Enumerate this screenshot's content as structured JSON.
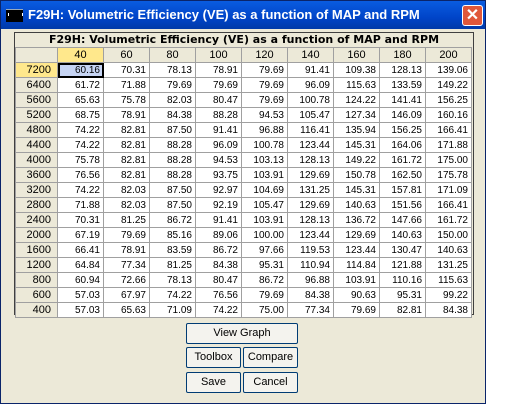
{
  "window": {
    "title": "F29H: Volumetric Efficiency (VE) as a function of MAP and RPM",
    "close_glyph": "✕"
  },
  "table": {
    "caption": "F29H: Volumetric Efficiency (VE) as a function of MAP and RPM",
    "columns": [
      "40",
      "60",
      "80",
      "100",
      "120",
      "140",
      "160",
      "180",
      "200"
    ],
    "selected_column": 0,
    "selected_row": 0,
    "rows": [
      {
        "rpm": "7200",
        "values": [
          "60.16",
          "70.31",
          "78.13",
          "78.91",
          "79.69",
          "91.41",
          "109.38",
          "128.13",
          "139.06"
        ]
      },
      {
        "rpm": "6400",
        "values": [
          "61.72",
          "71.88",
          "79.69",
          "79.69",
          "79.69",
          "96.09",
          "115.63",
          "133.59",
          "149.22"
        ]
      },
      {
        "rpm": "5600",
        "values": [
          "65.63",
          "75.78",
          "82.03",
          "80.47",
          "79.69",
          "100.78",
          "124.22",
          "141.41",
          "156.25"
        ]
      },
      {
        "rpm": "5200",
        "values": [
          "68.75",
          "78.91",
          "84.38",
          "88.28",
          "94.53",
          "105.47",
          "127.34",
          "146.09",
          "160.16"
        ]
      },
      {
        "rpm": "4800",
        "values": [
          "74.22",
          "82.81",
          "87.50",
          "91.41",
          "96.88",
          "116.41",
          "135.94",
          "156.25",
          "166.41"
        ]
      },
      {
        "rpm": "4400",
        "values": [
          "74.22",
          "82.81",
          "88.28",
          "96.09",
          "100.78",
          "123.44",
          "145.31",
          "164.06",
          "171.88"
        ]
      },
      {
        "rpm": "4000",
        "values": [
          "75.78",
          "82.81",
          "88.28",
          "94.53",
          "103.13",
          "128.13",
          "149.22",
          "161.72",
          "175.00"
        ]
      },
      {
        "rpm": "3600",
        "values": [
          "76.56",
          "82.81",
          "88.28",
          "93.75",
          "103.91",
          "129.69",
          "150.78",
          "162.50",
          "175.78"
        ]
      },
      {
        "rpm": "3200",
        "values": [
          "74.22",
          "82.03",
          "87.50",
          "92.97",
          "104.69",
          "131.25",
          "145.31",
          "157.81",
          "171.09"
        ]
      },
      {
        "rpm": "2800",
        "values": [
          "71.88",
          "82.03",
          "87.50",
          "92.19",
          "105.47",
          "129.69",
          "140.63",
          "151.56",
          "166.41"
        ]
      },
      {
        "rpm": "2400",
        "values": [
          "70.31",
          "81.25",
          "86.72",
          "91.41",
          "103.91",
          "128.13",
          "136.72",
          "147.66",
          "161.72"
        ]
      },
      {
        "rpm": "2000",
        "values": [
          "67.19",
          "79.69",
          "85.16",
          "89.06",
          "100.00",
          "123.44",
          "129.69",
          "140.63",
          "150.00"
        ]
      },
      {
        "rpm": "1600",
        "values": [
          "66.41",
          "78.91",
          "83.59",
          "86.72",
          "97.66",
          "119.53",
          "123.44",
          "130.47",
          "140.63"
        ]
      },
      {
        "rpm": "1200",
        "values": [
          "64.84",
          "77.34",
          "81.25",
          "84.38",
          "95.31",
          "110.94",
          "114.84",
          "121.88",
          "131.25"
        ]
      },
      {
        "rpm": "800",
        "values": [
          "60.94",
          "72.66",
          "78.13",
          "80.47",
          "86.72",
          "96.88",
          "103.91",
          "110.16",
          "115.63"
        ]
      },
      {
        "rpm": "600",
        "values": [
          "57.03",
          "67.97",
          "74.22",
          "76.56",
          "79.69",
          "84.38",
          "90.63",
          "95.31",
          "99.22"
        ]
      },
      {
        "rpm": "400",
        "values": [
          "57.03",
          "65.63",
          "71.09",
          "74.22",
          "75.00",
          "77.34",
          "79.69",
          "82.81",
          "84.38"
        ]
      }
    ]
  },
  "buttons": {
    "view_graph": "View Graph",
    "toolbox": "Toolbox",
    "compare": "Compare",
    "save": "Save",
    "cancel": "Cancel"
  },
  "colors": {
    "title_bar": "#0a5ce0",
    "selected_header": "#ffe88c",
    "selected_cell": "#c6d4f3",
    "window_bg": "#ece9d8"
  }
}
